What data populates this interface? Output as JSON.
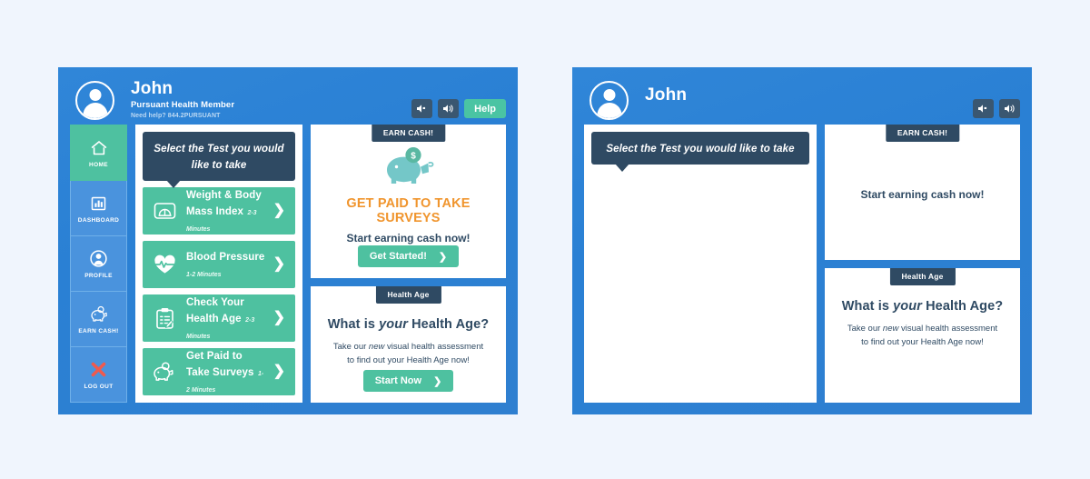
{
  "page": {
    "background_color": "#f0f5fd",
    "panel_gradient_start": "#3086d8",
    "panel_gradient_end": "#2f7fd0",
    "accent_teal": "#4ec1a0",
    "accent_orange": "#f0952e",
    "navy": "#2f4a63",
    "sidebar_blue": "#4a93dd"
  },
  "left_panel": {
    "header": {
      "avatar_icon": "user-avatar-icon",
      "user_name": "John",
      "user_role": "Pursuant Health Member",
      "help_line": "Need help? 844.2PURSUANT",
      "mute_icon": "speaker-mute-icon",
      "sound_icon": "speaker-on-icon",
      "help_label": "Help"
    },
    "sidebar": {
      "items": [
        {
          "label": "HOME",
          "icon": "home-icon",
          "active": true
        },
        {
          "label": "DASHBOARD",
          "icon": "bar-chart-icon",
          "active": false
        },
        {
          "label": "PROFILE",
          "icon": "user-circle-icon",
          "active": false
        },
        {
          "label": "EARN CASH!",
          "icon": "piggy-bank-icon",
          "active": false
        },
        {
          "label": "LOG OUT",
          "icon": "x-cross-icon",
          "active": false
        }
      ]
    },
    "test_list": {
      "tooltip": "Select the Test you would like to take",
      "items": [
        {
          "title": "Weight & Body Mass Index",
          "duration": "2-3 Minutes",
          "icon": "weight-scale-icon",
          "chevron": "❯"
        },
        {
          "title": "Blood Pressure",
          "duration": "1-2 Minutes",
          "icon": "heart-pulse-icon",
          "chevron": "❯"
        },
        {
          "title": "Check Your Health Age",
          "duration": "2-3 Minutes",
          "icon": "clipboard-check-icon",
          "chevron": "❯"
        },
        {
          "title": "Get Paid to Take Surveys",
          "duration": "1-2 Minutes",
          "icon": "piggy-bank-icon",
          "chevron": "❯"
        }
      ]
    },
    "earn_cash_card": {
      "badge": "EARN CASH!",
      "image_icon": "piggy-bank-illustration",
      "heading": "GET PAID TO TAKE SURVEYS",
      "subheading": "Start earning cash now!",
      "cta_label": "Get Started!",
      "cta_chevron": "❯"
    },
    "health_age_card": {
      "badge": "Health Age",
      "heading_before": "What is ",
      "heading_em": "your",
      "heading_after": " Health Age?",
      "body_line1_before": "Take our ",
      "body_line1_em": "new",
      "body_line1_after": " visual health assessment",
      "body_line2": "to find out your Health Age now!",
      "cta_label": "Start Now",
      "cta_chevron": "❯"
    }
  },
  "right_panel": {
    "header": {
      "avatar_icon": "user-avatar-icon",
      "user_name": "John",
      "mute_icon": "speaker-mute-icon",
      "sound_icon": "speaker-on-icon"
    },
    "test_list": {
      "tooltip": "Select the Test you would like to take"
    },
    "earn_cash_card": {
      "badge": "EARN CASH!",
      "subheading": "Start earning cash now!"
    },
    "health_age_card": {
      "badge": "Health Age",
      "heading_before": "What is ",
      "heading_em": "your",
      "heading_after": " Health Age?",
      "body_line1_before": "Take our ",
      "body_line1_em": "new",
      "body_line1_after": " visual health assessment",
      "body_line2": "to find out your Health Age now!"
    }
  }
}
